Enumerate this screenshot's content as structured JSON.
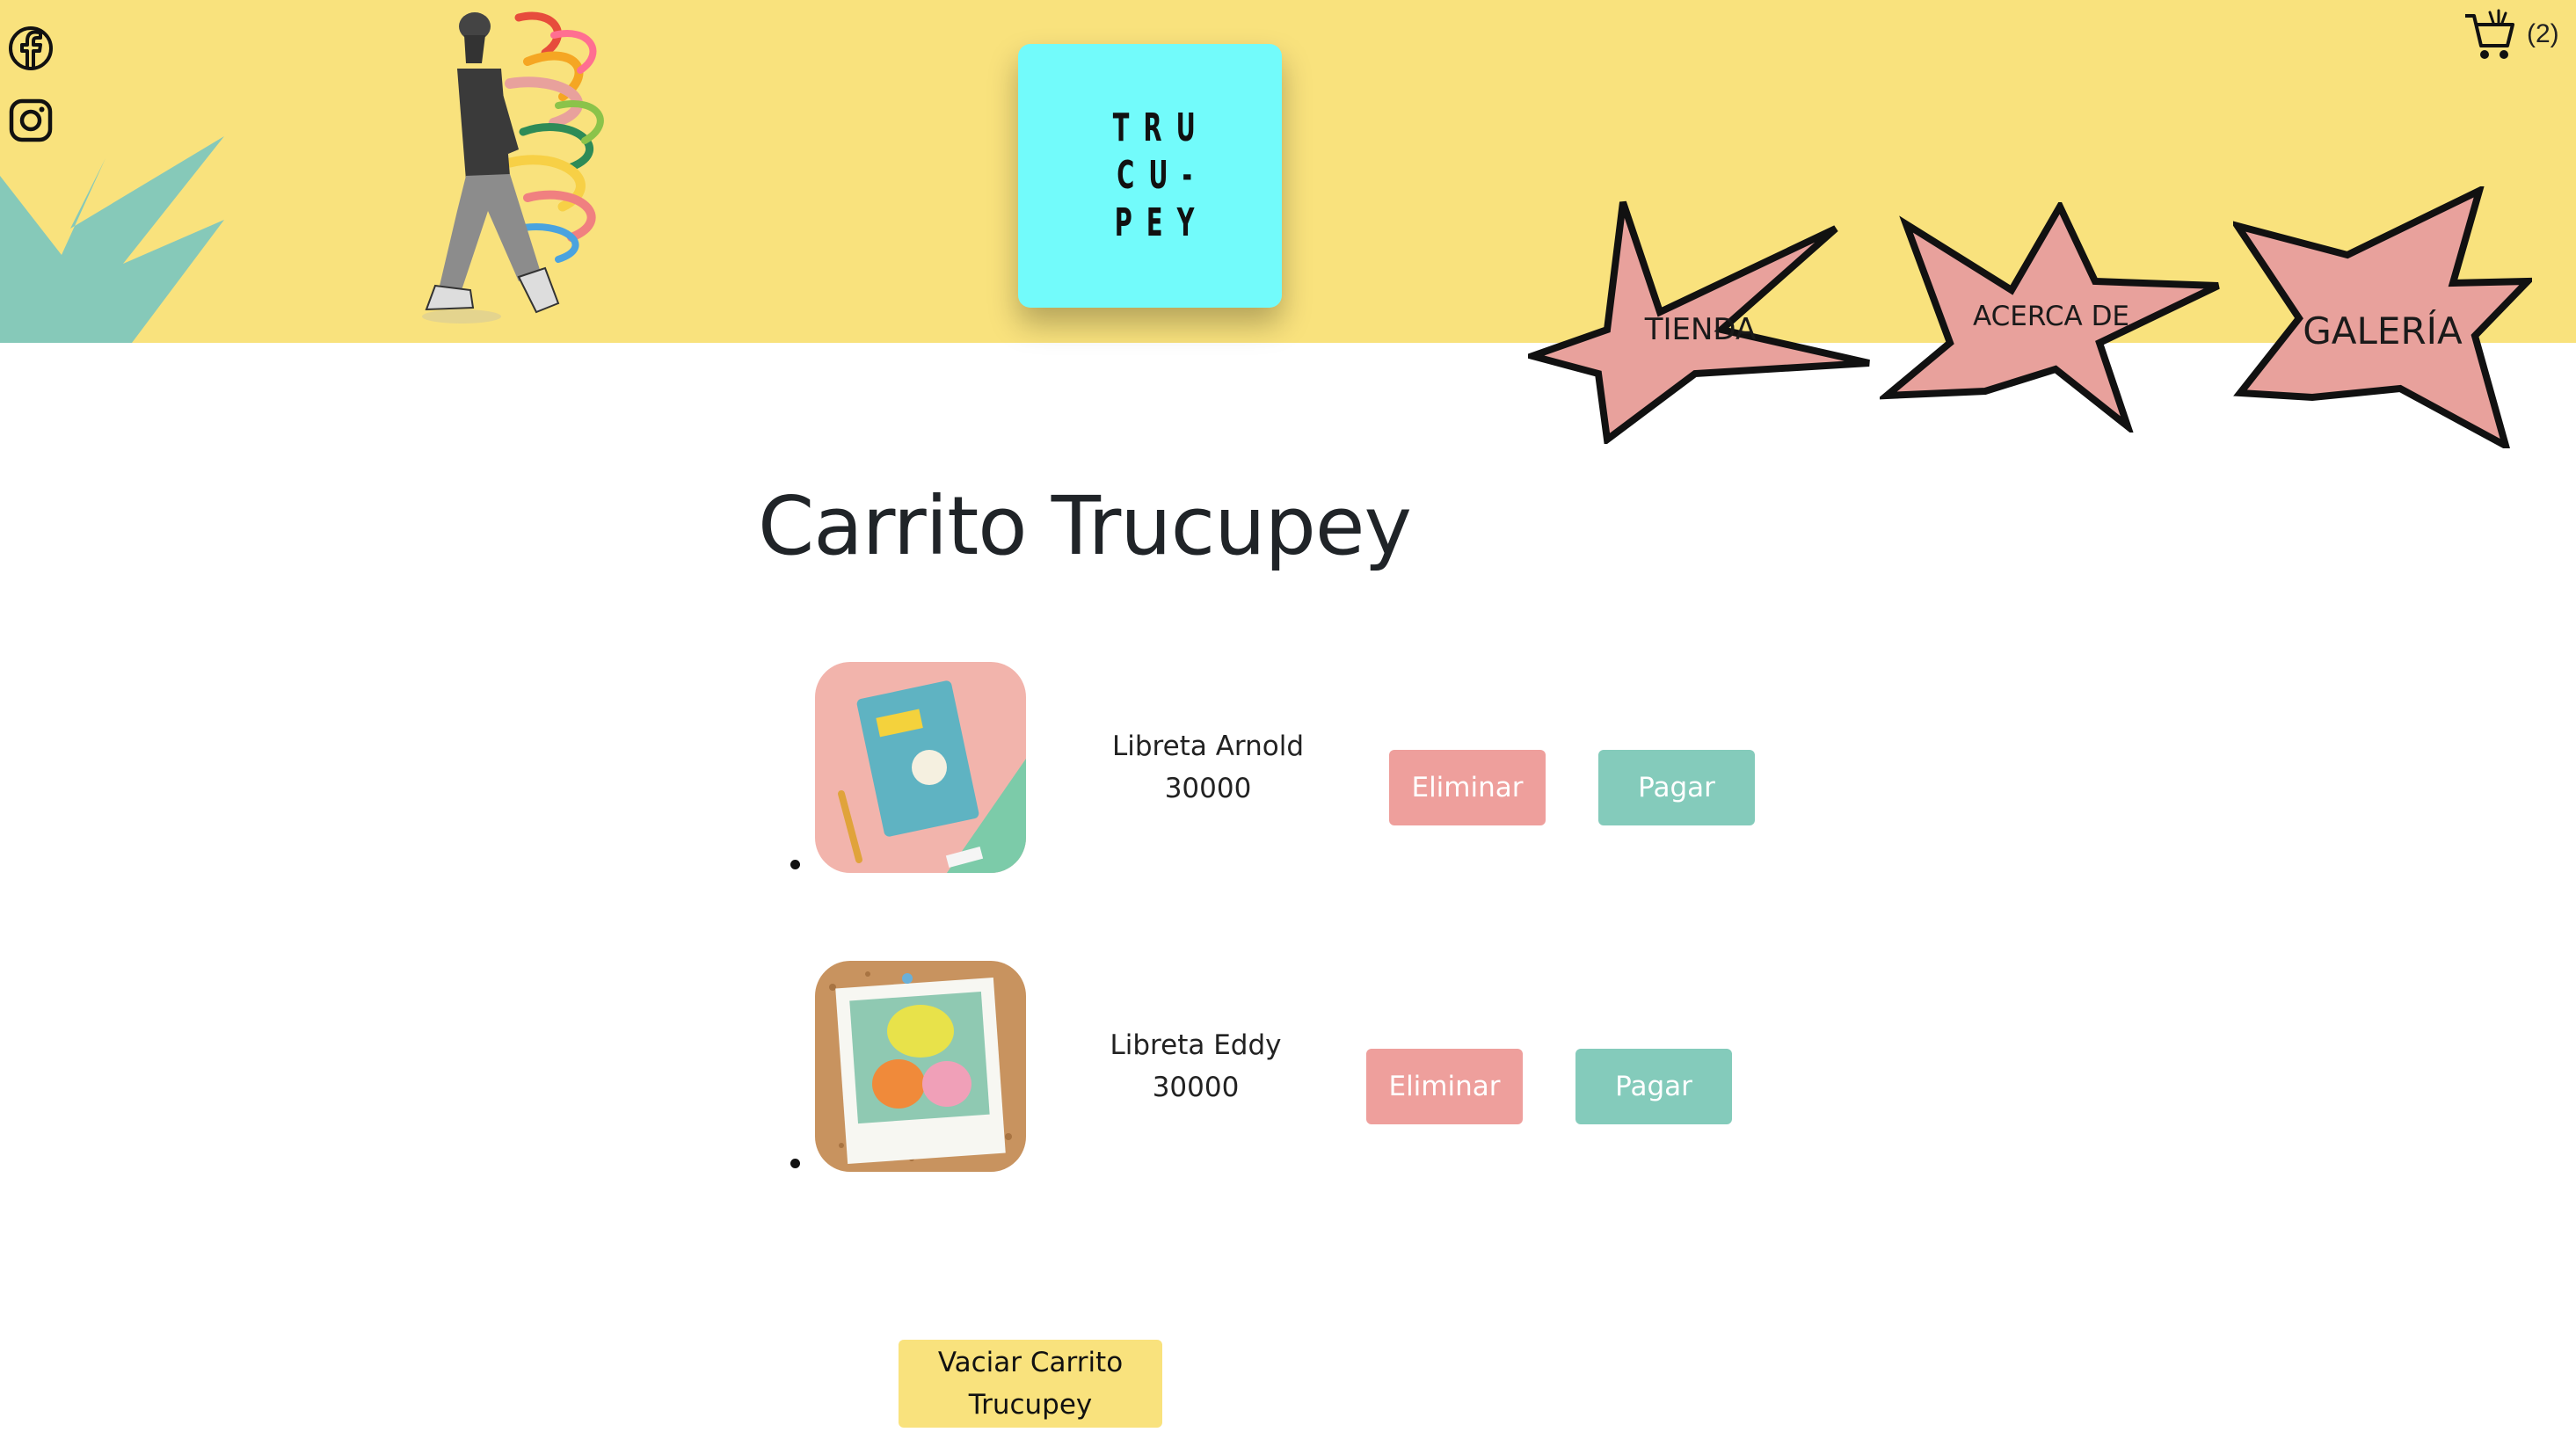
{
  "header": {
    "logo_lines": [
      "TRU",
      "CU-",
      "PEY"
    ],
    "social": [
      {
        "icon": "facebook-icon"
      },
      {
        "icon": "instagram-icon"
      }
    ],
    "cart": {
      "icon": "shopping-cart-icon",
      "count": "(2)"
    },
    "nav": [
      {
        "label": "TIENDA"
      },
      {
        "label": "ACERCA DE"
      },
      {
        "label": "GALERÍA"
      }
    ]
  },
  "main": {
    "title": "Carrito Trucupey",
    "items": [
      {
        "name": "Libreta Arnold",
        "price": "30000",
        "remove_label": "Eliminar",
        "pay_label": "Pagar"
      },
      {
        "name": "Libreta Eddy",
        "price": "30000",
        "remove_label": "Eliminar",
        "pay_label": "Pagar"
      }
    ],
    "empty_cart_label": "Vaciar Carrito Trucupey"
  },
  "colors": {
    "header_bg": "#f9e27d",
    "logo_bg": "#72fbfb",
    "star_fill": "#e8a19c",
    "remove_button": "#ee9f9c",
    "pay_button": "#84cbbb",
    "accent_teal": "#86c9b9"
  }
}
